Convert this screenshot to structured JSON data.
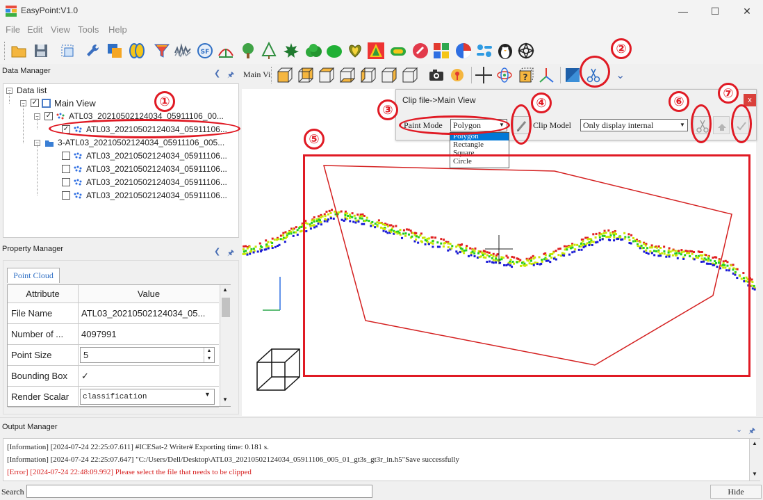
{
  "window": {
    "title": "EasyPoint:V1.0",
    "minimize": "—",
    "maximize": "☐",
    "close": "✕"
  },
  "menu": {
    "items": [
      "File",
      "Edit",
      "View",
      "Tools",
      "Help"
    ]
  },
  "data_manager": {
    "title": "Data Manager",
    "tree": {
      "root": "Data list",
      "main_view": "Main View",
      "items": [
        "ATL03_20210502124034_05911106_00...",
        "ATL03_20210502124034_05911106...",
        "3-ATL03_20210502124034_05911106_005...",
        "ATL03_20210502124034_05911106...",
        "ATL03_20210502124034_05911106...",
        "ATL03_20210502124034_05911106...",
        "ATL03_20210502124034_05911106..."
      ]
    }
  },
  "property_manager": {
    "title": "Property Manager",
    "tab": "Point Cloud",
    "columns": [
      "Attribute",
      "Value"
    ],
    "rows": [
      {
        "attr": "File Name",
        "value": "ATL03_20210502124034_05..."
      },
      {
        "attr": "Number of ...",
        "value": "4097991"
      },
      {
        "attr": "Point Size",
        "value": "5"
      },
      {
        "attr": "Bounding Box",
        "value": "✓"
      },
      {
        "attr": "Render Scalar",
        "value": "classification"
      }
    ]
  },
  "view_toolbar": {
    "tab_label": "Main Vi"
  },
  "clip_dialog": {
    "title": "Clip file->Main View",
    "close": "x",
    "paint_mode_label": "Paint Mode",
    "paint_mode_value": "Polygon",
    "paint_mode_options": [
      "Polygon",
      "Rectangle",
      "Square",
      "Circle"
    ],
    "clip_model_label": "Clip Model",
    "clip_model_value": "Only display internal"
  },
  "annotations": [
    "①",
    "②",
    "③",
    "④",
    "⑤",
    "⑥",
    "⑦"
  ],
  "output_manager": {
    "title": "Output Manager",
    "logs": [
      {
        "text": "[Information]  [2024-07-24 22:25:07.611] #ICESat-2 Writer# Exporting time: 0.181 s.",
        "type": "info"
      },
      {
        "text": "[Information]  [2024-07-24 22:25:07.647]  \"C:/Users/Dell/Desktop\\ATL03_20210502124034_05911106_005_01_gt3s_gt3r_in.h5\"Save successfully",
        "type": "info"
      },
      {
        "text": "[Error]  [2024-07-24 22:48:09.992] Please select the file that needs to be clipped",
        "type": "error"
      }
    ]
  },
  "search": {
    "label": "Search",
    "value": "",
    "hide_button": "Hide"
  },
  "colors": {
    "annotation_red": "#e01a24",
    "error_text": "#d62020",
    "selection_blue": "#0078d7",
    "point_yellow": "#c8e600",
    "point_green": "#22cc22",
    "point_blue": "#1a1ad6",
    "point_red": "#e02020"
  }
}
